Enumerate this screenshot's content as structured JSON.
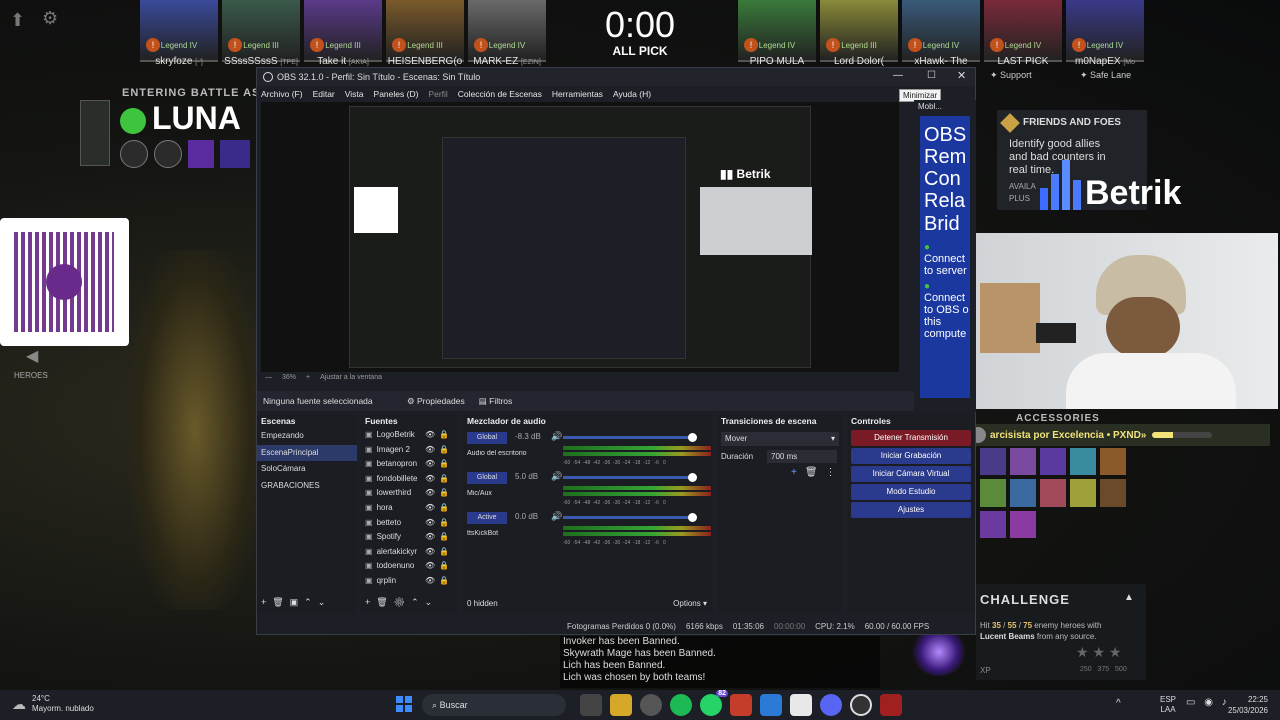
{
  "game": {
    "timer": "0:00",
    "mode": "ALL PICK",
    "entering_battle": "ENTERING BATTLE AS",
    "hero_name": "LUNA",
    "heroes_label": "HEROES",
    "players": [
      {
        "name": "skryfoze",
        "rank": "Legend IV",
        "tag": "[-']"
      },
      {
        "name": "SSssSSssS",
        "rank": "Legend III",
        "tag": "[TPE]"
      },
      {
        "name": "Take it",
        "rank": "Legend III",
        "tag": "[AKIA]"
      },
      {
        "name": "HEISENBERG(o",
        "rank": "Legend III",
        "tag": ""
      },
      {
        "name": "MARK-EZ",
        "rank": "Legend IV",
        "tag": "[EZIN]"
      },
      {
        "name": "PIPO MULA",
        "rank": "Legend IV",
        "tag": ""
      },
      {
        "name": "Lord Dolor(",
        "rank": "Legend III",
        "tag": ""
      },
      {
        "name": "xHawk- The",
        "rank": "Legend IV",
        "tag": ""
      },
      {
        "name": "LAST PICK",
        "rank": "Legend IV",
        "tag": ""
      },
      {
        "name": "m0NapEX",
        "rank": "Legend IV",
        "tag": "[Mo"
      }
    ],
    "roles": {
      "support": "Support",
      "safe_lane": "Safe Lane"
    },
    "friends_foes": {
      "title": "FRIENDS AND FOES",
      "text": "Identify good allies and bad counters in real time.",
      "avail": "AVAILA",
      "plus": "PLUS"
    },
    "betrik": "Betrik",
    "accessories": "ACCESSORIES",
    "ticker": "arcisista por Excelencia  •  PXND»",
    "challenge": {
      "title": "CHALLENGE",
      "text_pre": "Hit ",
      "n1": "35",
      "n2": "55",
      "n3": "75",
      "text_mid": " enemy heroes with",
      "hero": "Lucent Beams",
      "text_post": " from any source.",
      "xp": "XP",
      "xp_vals": "250   375   500"
    },
    "chat": [
      "Invoker has been Banned.",
      "Skywrath Mage has been Banned.",
      "Lich has been Banned.",
      "Lich was chosen by both teams!"
    ]
  },
  "obs": {
    "title": "OBS 32.1.0 - Perfil: Sin Título - Escenas: Sin Título",
    "tooltip": "Minimizar",
    "menu": [
      "Archivo (F)",
      "Editar",
      "Vista",
      "Paneles (D)",
      "Perfil",
      "Colección de Escenas",
      "Herramientas",
      "Ayuda (H)"
    ],
    "zoom": "36%",
    "fit": "Ajustar a la ventana",
    "no_source": "Ninguna fuente seleccionada",
    "properties": "Propiedades",
    "filters": "Filtros",
    "scenes_title": "Escenas",
    "scenes": [
      "Empezando",
      "EscenaPrincipal",
      "SoloCámara",
      "GRABACIONES"
    ],
    "sources_title": "Fuentes",
    "sources": [
      "LogoBetrik",
      "Imagen 2",
      "betanopron",
      "fondobillete",
      "lowerthird",
      "hora",
      "betteto",
      "Spotify",
      "alertakickyr",
      "todoenuno",
      "qrplin"
    ],
    "mixer_title": "Mezclador de audio",
    "mixer": [
      {
        "badge": "Global",
        "db": "-8.3 dB",
        "name": "Audio del escritorio"
      },
      {
        "badge": "Global",
        "db": "5.0 dB",
        "name": "Mic/Aux"
      },
      {
        "badge": "Active",
        "db": "0.0 dB",
        "name": "ttsKickBot"
      }
    ],
    "meter_scale": "-60  -54  -48  -42  -36  -30  -24  -18  -12   -6   0",
    "hidden": "0 hidden",
    "options": "Options",
    "transitions_title": "Transiciones de escena",
    "transition": "Mover",
    "duration_label": "Duración",
    "duration": "700 ms",
    "controls_title": "Controles",
    "controls": [
      "Detener Transmisión",
      "Iniciar Grabación",
      "Iniciar Cámara Virtual",
      "Modo Estudio",
      "Ajustes"
    ],
    "status": {
      "frames": "Fotogramas Perdidos 0 (0.0%)",
      "kbps": "6166 kbps",
      "stream_time": "01:35:06",
      "rec_time": "00:00:00",
      "cpu": "CPU: 2.1%",
      "fps": "60.00 / 60.00 FPS"
    },
    "dock": {
      "title": "Mobl...",
      "lines": [
        "OBS",
        "Rem",
        "Con",
        "Rela",
        "Brid",
        "Connect",
        "to server",
        "Connect",
        "to OBS o",
        "this",
        "compute"
      ]
    }
  },
  "taskbar": {
    "weather_temp": "24°C",
    "weather_desc": "Mayorm. nublado",
    "search": "Buscar",
    "lang": "ESP",
    "lang2": "LAA",
    "time": "22:25",
    "date": "25/03/2026",
    "badge_whatsapp": "82"
  },
  "colors": {
    "accent": "#2a3a8c",
    "obs_bg": "#1d1f26",
    "stop_stream": "#7a1a24",
    "betrik": "#4a7bff",
    "taskbar": "#1c1f26"
  }
}
